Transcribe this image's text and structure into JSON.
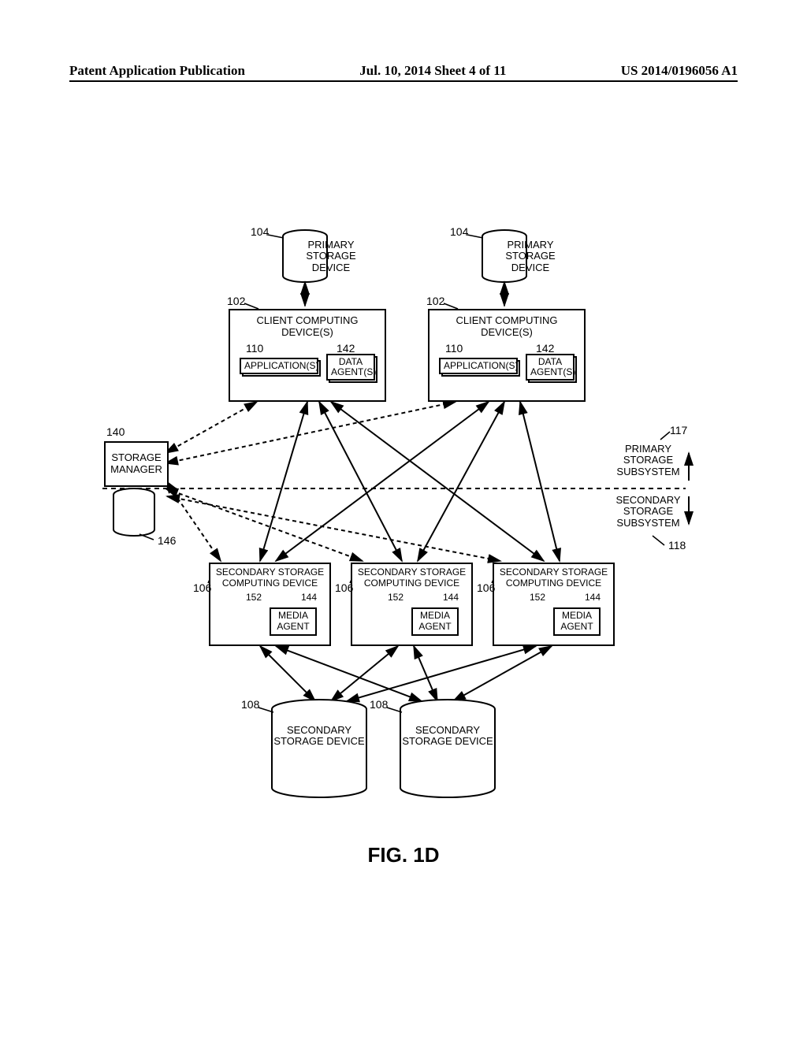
{
  "header": {
    "left": "Patent Application Publication",
    "center": "Jul. 10, 2014  Sheet 4 of 11",
    "right": "US 2014/0196056 A1"
  },
  "refs": {
    "r104a": "104",
    "r104b": "104",
    "r102a": "102",
    "r102b": "102",
    "r110a": "110",
    "r110b": "110",
    "r142a": "142",
    "r142b": "142",
    "r140": "140",
    "r146": "146",
    "r117": "117",
    "r118": "118",
    "r106a": "106",
    "r106b": "106",
    "r106c": "106",
    "r152a": "152",
    "r152b": "152",
    "r152c": "152",
    "r144a": "144",
    "r144b": "144",
    "r144c": "144",
    "r108a": "108",
    "r108b": "108"
  },
  "labels": {
    "primary_storage_device": "PRIMARY\nSTORAGE\nDEVICE",
    "client_computing": "CLIENT COMPUTING\nDEVICE(S)",
    "applications": "APPLICATION(S)",
    "data_agents": "DATA\nAGENT(S)",
    "storage_manager": "STORAGE\nMANAGER",
    "primary_subsystem": "PRIMARY\nSTORAGE\nSUBSYSTEM",
    "secondary_subsystem": "SECONDARY\nSTORAGE\nSUBSYSTEM",
    "secondary_storage_computing": "SECONDARY STORAGE\nCOMPUTING DEVICE",
    "media_agent": "MEDIA\nAGENT",
    "secondary_storage_device": "SECONDARY\nSTORAGE DEVICE"
  },
  "figure": "FIG. 1D"
}
